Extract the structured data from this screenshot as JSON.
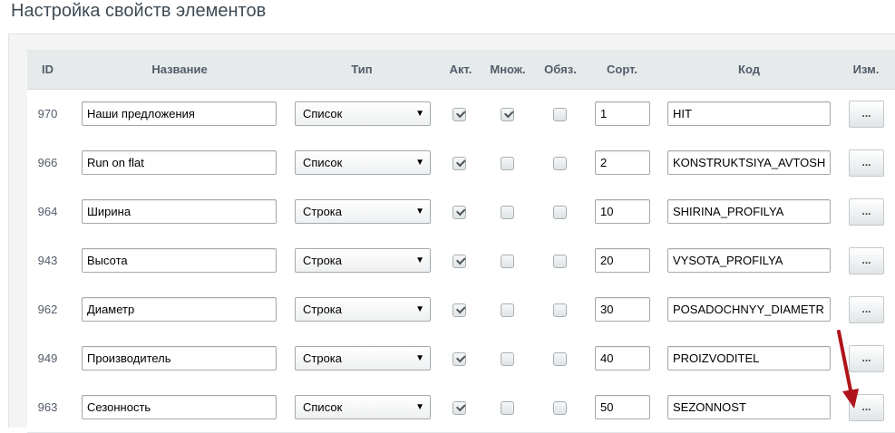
{
  "page": {
    "title": "Настройка свойств элементов"
  },
  "table": {
    "headers": {
      "id": "ID",
      "name": "Название",
      "type": "Тип",
      "active": "Акт.",
      "multiple": "Множ.",
      "required": "Обяз.",
      "sort": "Сорт.",
      "code": "Код",
      "edit": "Изм."
    },
    "edit_label": "...",
    "select_arrow": "▼",
    "rows": [
      {
        "id": "970",
        "name": "Наши предложения",
        "type": "Список",
        "active": true,
        "multiple": true,
        "required": false,
        "sort": "1",
        "code": "HIT"
      },
      {
        "id": "966",
        "name": "Run on flat",
        "type": "Список",
        "active": true,
        "multiple": false,
        "required": false,
        "sort": "2",
        "code": "KONSTRUKTSIYA_AVTOSH"
      },
      {
        "id": "964",
        "name": "Ширина",
        "type": "Строка",
        "active": true,
        "multiple": false,
        "required": false,
        "sort": "10",
        "code": "SHIRINA_PROFILYA"
      },
      {
        "id": "943",
        "name": "Высота",
        "type": "Строка",
        "active": true,
        "multiple": false,
        "required": false,
        "sort": "20",
        "code": "VYSOTA_PROFILYA"
      },
      {
        "id": "962",
        "name": "Диаметр",
        "type": "Строка",
        "active": true,
        "multiple": false,
        "required": false,
        "sort": "30",
        "code": "POSADOCHNYY_DIAMETR"
      },
      {
        "id": "949",
        "name": "Производитель",
        "type": "Строка",
        "active": true,
        "multiple": false,
        "required": false,
        "sort": "40",
        "code": "PROIZVODITEL"
      },
      {
        "id": "963",
        "name": "Сезонность",
        "type": "Список",
        "active": true,
        "multiple": false,
        "required": false,
        "sort": "50",
        "code": "SEZONNOST"
      }
    ]
  },
  "colors": {
    "annotation_arrow": "#b0141b",
    "header_bg": "#e6eaeb"
  }
}
